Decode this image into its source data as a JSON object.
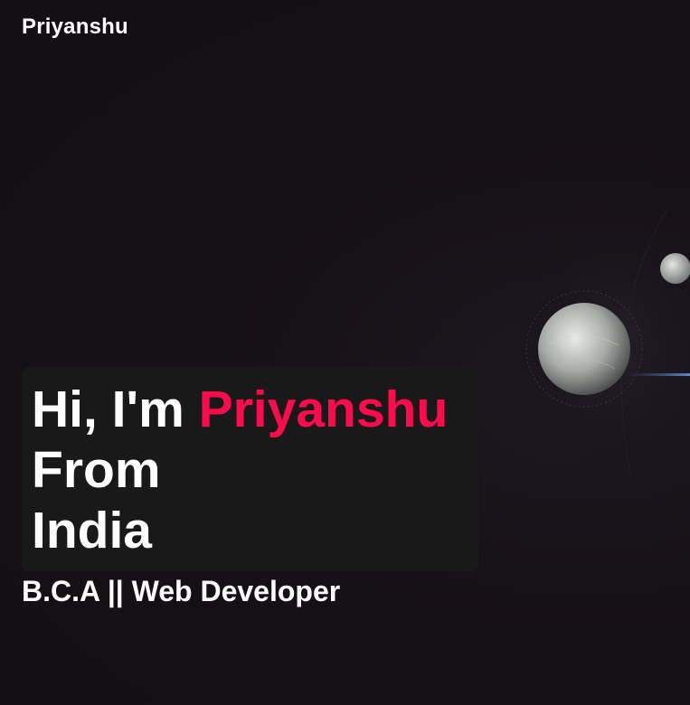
{
  "header": {
    "brand": "Priyanshu"
  },
  "hero": {
    "greeting": "Hi, I'm ",
    "name": "Priyanshu",
    "line2": "From",
    "line3": "India"
  },
  "subtitle": "B.C.A || Web Developer",
  "colors": {
    "background": "#140f14",
    "hero_box": "#191919",
    "accent": "#ff0b4d",
    "text": "#ffffff"
  },
  "decoration": {
    "icon": "planet-orbit-icon"
  }
}
